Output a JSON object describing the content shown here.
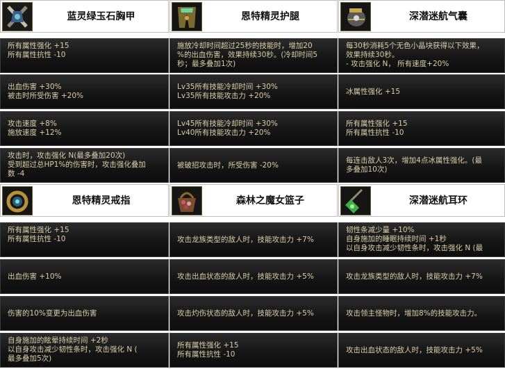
{
  "cards": [
    {
      "title": "蓝灵绿玉石胸甲",
      "icon": "breastplate-icon",
      "rows": [
        [
          "所有属性强化 +15",
          "所有属性抗性 -10"
        ],
        [
          "出血伤害 +30%",
          "被击时所受伤害 +20%"
        ],
        [
          "攻击速度 +8%",
          "施放速度 +12%"
        ],
        [
          "攻击时，攻击强化 N(最多叠加20次)",
          "受到超过总HP1%的伤害时，攻击强化叠加",
          "数 -4"
        ]
      ]
    },
    {
      "title": "恩特精灵护腿",
      "icon": "leg-armor-icon",
      "rows": [
        [
          "施放冷却时间超过25秒的技能时，增加20",
          "%的出血伤害，效果持续30秒。(冷却时间5",
          "秒；最多叠加1次)"
        ],
        [
          "Lv35所有技能冷却时间 +30%",
          "Lv35所有技能攻击力 +20%"
        ],
        [
          "Lv45所有技能冷却时间 +30%",
          "Lv40所有技能攻击力 +20%"
        ],
        [
          "被破招攻击时，所受伤害 -20%"
        ]
      ]
    },
    {
      "title": "深潜迷航气囊",
      "icon": "air-bladder-icon",
      "rows": [
        [
          "每30秒消耗5个无色小晶块获得以下效果，",
          "效果持续30秒。",
          "- 攻击强化 N， 所有速度+20%"
        ],
        [
          "冰属性强化 +15"
        ],
        [
          "所有属性强化 +15",
          "所有属性抗性 -10"
        ],
        [
          "每连击敌人3次，增加4点冰属性强化。(最",
          "多叠加10次)"
        ]
      ]
    },
    {
      "title": "恩特精灵戒指",
      "icon": "ring-icon",
      "rows": [
        [
          "所有属性强化 +15",
          "所有属性抗性 -10"
        ],
        [
          "出血伤害 +10%"
        ],
        [
          "伤害的10%变更为出血伤害"
        ],
        [
          "自身施加的眩晕持续时间 +2秒",
          "以自身攻击减少韧性条时，攻击强化 N (",
          "最多叠加5次)"
        ]
      ]
    },
    {
      "title": "森林之魔女篮子",
      "icon": "witch-basket-icon",
      "rows": [
        [
          "攻击龙族类型的敌人时，技能攻击力 +7%"
        ],
        [
          "攻击出血状态的敌人时，技能攻击力 +5%"
        ],
        [
          "攻击灼伤状态的敌人时，技能攻击力 +5%"
        ],
        [
          "所有属性强化 +15",
          "所有属性抗性 -10"
        ]
      ]
    },
    {
      "title": "深潜迷航耳环",
      "icon": "earring-icon",
      "rows": [
        [
          "韧性条减少量 +10%",
          "自身施加的睡眠持续时间 +1秒",
          "以自身攻击减少韧性条时，攻击强化 N (最"
        ],
        [
          "攻击龙族类型的敌人时，技能攻击力 +7%"
        ],
        [
          "攻击领主怪物时，增加8%的技能攻击力。"
        ],
        [
          "攻击出血状态的敌人时，技能攻击力 +5%"
        ]
      ]
    }
  ]
}
